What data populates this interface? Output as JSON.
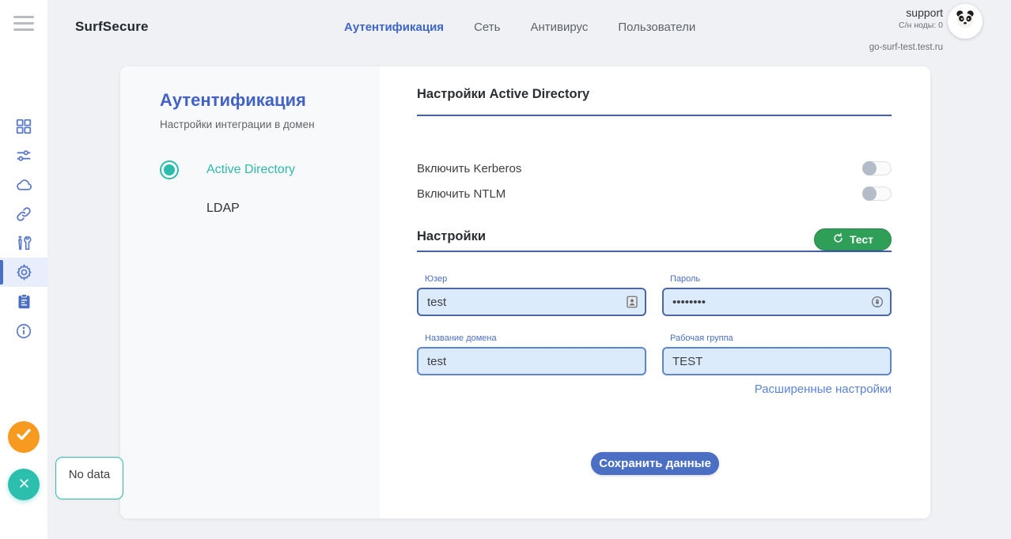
{
  "brand": {
    "name": "SurfSecure"
  },
  "header": {
    "nav": [
      {
        "label": "Аутентификация",
        "active": true
      },
      {
        "label": "Сеть",
        "active": false
      },
      {
        "label": "Антивирус",
        "active": false
      },
      {
        "label": "Пользователи",
        "active": false
      }
    ],
    "user": {
      "name": "support",
      "nodes": "С/н ноды: 0",
      "host": "go-surf-test.test.ru"
    }
  },
  "sidebar": {
    "items": [
      {
        "icon": "dashboard-icon",
        "active": false
      },
      {
        "icon": "tune-icon",
        "active": false
      },
      {
        "icon": "cloud-icon",
        "active": false
      },
      {
        "icon": "link-icon",
        "active": false
      },
      {
        "icon": "tools-icon",
        "active": false
      },
      {
        "icon": "gear-icon",
        "active": true
      },
      {
        "icon": "clipboard-icon",
        "active": false
      },
      {
        "icon": "info-icon",
        "active": false
      }
    ]
  },
  "auth_panel": {
    "title": "Аутентификация",
    "subtitle": "Настройки интеграции в домен",
    "options": [
      {
        "label": "Active Directory",
        "selected": true
      },
      {
        "label": "LDAP",
        "selected": false
      }
    ]
  },
  "settings_panel": {
    "section1_title": "Настройки Active Directory",
    "toggles": [
      {
        "label": "Включить Kerberos",
        "on": false
      },
      {
        "label": "Включить NTLM",
        "on": false
      }
    ],
    "section2_title": "Настройки",
    "test_button_label": "Тест",
    "fields": [
      {
        "label": "Юзер",
        "value": "test"
      },
      {
        "label": "Пароль",
        "value": "••••••••"
      },
      {
        "label": "Название домена",
        "value": "test"
      },
      {
        "label": "Рабочая группа",
        "value": "TEST"
      }
    ],
    "advanced_link": "Расширенные настройки",
    "save_button_label": "Сохранить данные"
  },
  "floating": {
    "tooltip_text": "No data"
  },
  "colors": {
    "accent_blue": "#4a6fc3",
    "underline_blue": "#3d5fc1",
    "teal": "#2bbcab",
    "green": "#2f9e57",
    "orange": "#f79a1f",
    "input_bg": "#dcebfc",
    "page_bg": "#eff1f5",
    "panel_bg": "#f8f9fb"
  }
}
